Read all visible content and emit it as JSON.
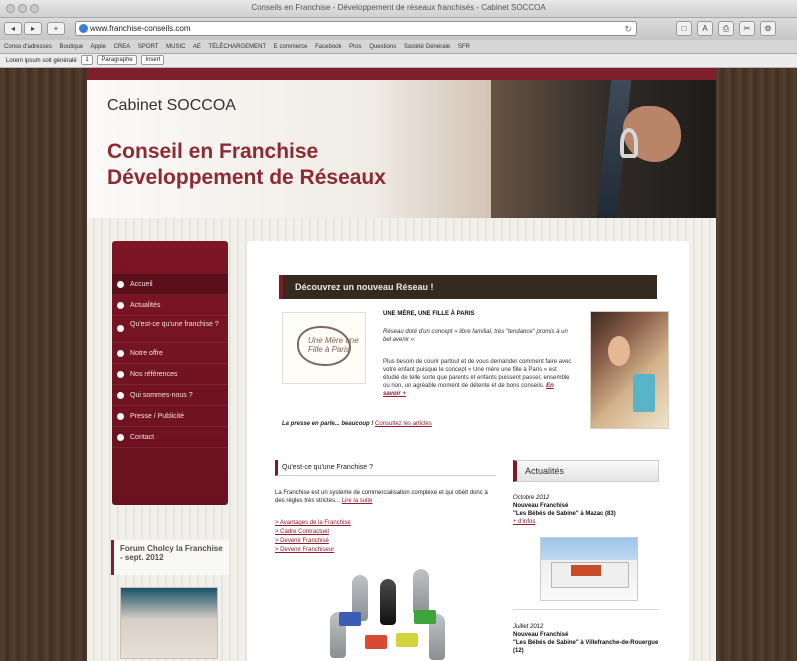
{
  "browser": {
    "window_title": "Conseils en Franchise - Développement de réseaux franchisés - Cabinet SOCCOA",
    "url": "www.franchise-conseils.com",
    "bookmarks": [
      "Conso d'adresses",
      "Boutique",
      "Apple",
      "CREA",
      "SPORT",
      "MUSIC",
      "AE",
      "TÉLÉCHARGEMENT",
      "E commerce",
      "Facebook",
      "Pros",
      "Questions",
      "Société Générale",
      "SFR"
    ],
    "edit_label": "Lorem ipsum soit généralé",
    "edit_value": "1",
    "edit_dropdown": "Paragraphe",
    "edit_button": "Insert"
  },
  "site": {
    "brand": "Cabinet SOCCOA",
    "headline_line1": "Conseil en Franchise",
    "headline_line2": "Développement de Réseaux",
    "menu": [
      {
        "label": "Accueil"
      },
      {
        "label": "Actualités"
      },
      {
        "label": "Qu'est-ce qu'une franchise ?"
      },
      {
        "label": "Notre offre"
      },
      {
        "label": "Nos références"
      },
      {
        "label": "Qui sommes-nous ?"
      },
      {
        "label": "Presse / Publicité"
      },
      {
        "label": "Contact"
      }
    ],
    "forum_box": "Forum Cholcy la Franchise - sept. 2012",
    "feature": {
      "title": "Découvrez un nouveau Réseau !",
      "logo_text": "Une Mère une Fille à Paris",
      "headline": "UNE MÈRE, UNE FILLE À PARIS",
      "p1": "Réseau doté d'un concept « libre familial, très \"tendance\" promis à un bel avenir ».",
      "p2": "Plus besoin de courir partout et de vous demander comment faire avec votre enfant puisque le concept « Une mère une fille à Paris » est étudié de telle sorte que parents et enfants puissent passer, ensemble ou non, un agréable moment de détente et de bons conseils. ",
      "more": "En savoir +",
      "press_prefix": "La presse en parle... beaucoup ! ",
      "press_link": "Consultez les articles"
    },
    "section": {
      "title": "Qu'est-ce qu'une Franchise ?",
      "text": "La Franchise est un système de commercialisation complexe et qui obéit donc à des règles très strictes... ",
      "text_link": "Lire la suite",
      "links": [
        "> Avantages de la Franchise",
        "> Cadre Contractuel",
        "> Devenir Franchisé",
        "> Devenir Franchiseur"
      ]
    },
    "news": {
      "title": "Actualités",
      "items": [
        {
          "date": "Octobre 2012",
          "label": "Nouveau Franchisé",
          "subtitle": "\"Les Bébés de Sabine\" à Mazac (83)",
          "link": "+ d'infos"
        },
        {
          "date": "Juillet 2012",
          "label": "Nouveau Franchisé",
          "subtitle": "\"Les Bébés de Sabine\" à Villefranche-de-Rouergue (12)"
        }
      ]
    }
  }
}
